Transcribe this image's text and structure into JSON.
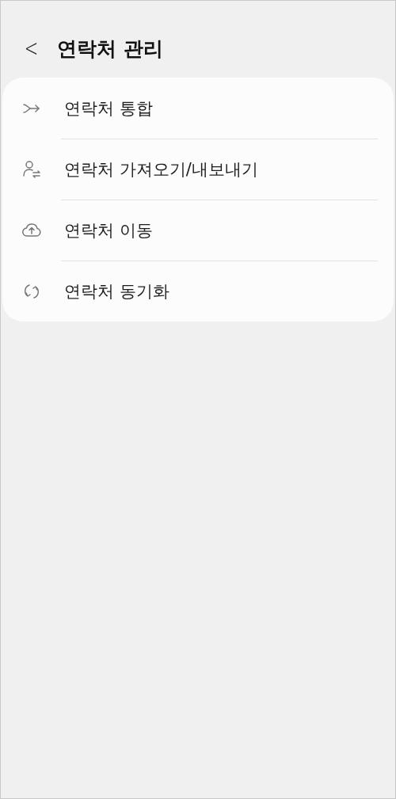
{
  "header": {
    "back": "<",
    "title": "연락처 관리"
  },
  "items": [
    {
      "kind": "merge",
      "label": "연락처 통합"
    },
    {
      "kind": "import-export",
      "label": "연락처 가져오기/내보내기"
    },
    {
      "kind": "move",
      "label": "연락처 이동"
    },
    {
      "kind": "sync",
      "label": "연락처 동기화"
    }
  ]
}
